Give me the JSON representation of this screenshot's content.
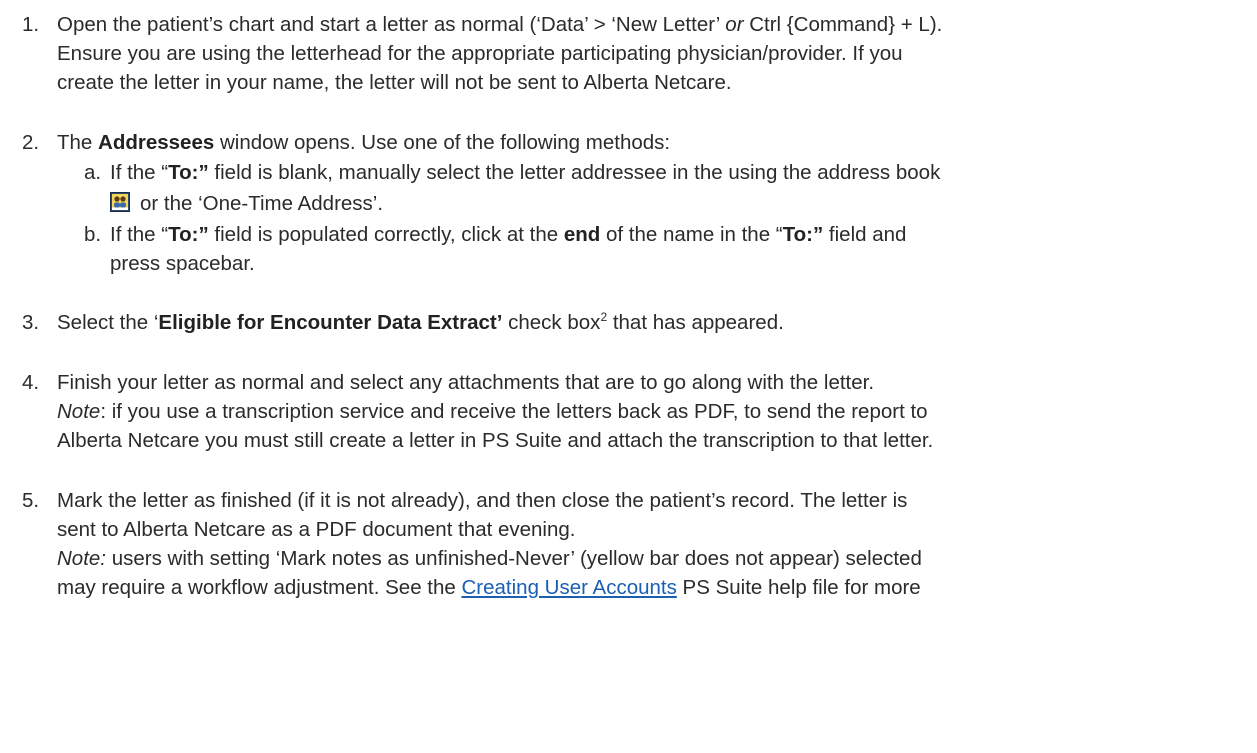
{
  "steps": [
    {
      "num": "1.",
      "line1_a": "Open the patient’s chart and start a letter as normal (‘Data’ > ‘New Letter’ ",
      "line1_or": "or",
      "line1_b": " Ctrl {Command} + L).",
      "line2": "Ensure you are using the letterhead for the appropriate participating physician/provider. If you",
      "line3": "create the letter in your name, the letter will not be sent to Alberta Netcare."
    },
    {
      "num": "2.",
      "pre": "The ",
      "bold": "Addressees",
      "post": " window opens. Use one of the following methods:",
      "subs": [
        {
          "letter": "a.",
          "t1": "If the “",
          "b1": "To:”",
          "t2": " field is blank, manually select the letter addressee in the using the address book",
          "t3": "or the ‘One-Time Address’."
        },
        {
          "letter": "b.",
          "t1": "If the “",
          "b1": "To:”",
          "t2": " field is populated correctly, click at the ",
          "b2": "end",
          "t3": " of the name in the “",
          "b3": "To:”",
          "t4": " field and",
          "t5": "press spacebar."
        }
      ]
    },
    {
      "num": "3.",
      "pre": "Select the ‘",
      "bold": "Eligible for Encounter Data Extract’",
      "post": " check box",
      "sup": "2",
      "post2": " that has appeared."
    },
    {
      "num": "4.",
      "line1": "Finish your letter as normal and select any attachments that are to go along with the letter.",
      "note_label": "Note",
      "line2": ": if you use a transcription service and receive the letters back as PDF, to send the report to",
      "line3": "Alberta Netcare you must still create a letter in PS Suite and attach the transcription to that letter."
    },
    {
      "num": "5.",
      "line1": "Mark the letter as finished (if it is not already), and then close the patient’s record. The letter is",
      "line2": "sent to Alberta Netcare as a PDF document that evening.",
      "note_label": "Note:",
      "line3": " users with setting ‘Mark notes as unfinished-Never’ (yellow bar does not appear) selected",
      "line4": "may require a workflow adjustment. See the ",
      "link": "Creating User Accounts",
      "line4_b": " PS Suite help file for more"
    }
  ],
  "icons": {
    "address_book": "address-book-icon"
  },
  "colors": {
    "link": "#1a5fb4",
    "text": "#2b2b2b"
  }
}
